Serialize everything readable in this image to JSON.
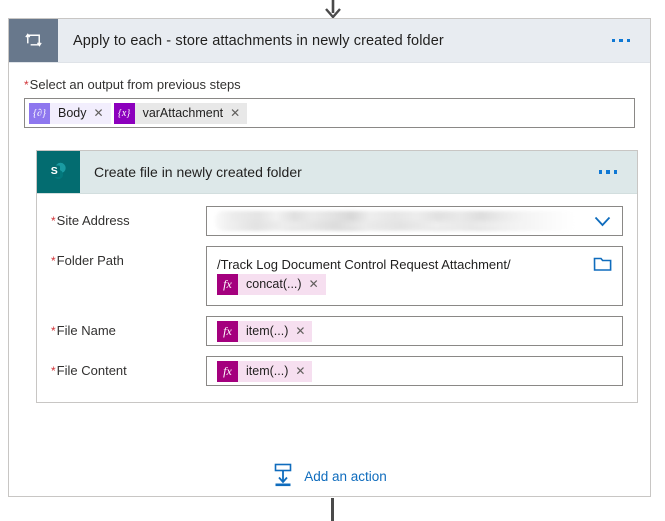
{
  "connector": {
    "top_arrow_icon": "arrow-down-icon",
    "bottom_stub_icon": "connector-line"
  },
  "loop_card": {
    "icon": "apply-to-each-loop-icon",
    "title": "Apply to each - store attachments in newly created folder",
    "menu_icon": "ellipsis-icon",
    "input_field": {
      "required": true,
      "asterisk": "*",
      "label": "Select an output from previous steps",
      "tokens": [
        {
          "icon_glyph": "{∂}",
          "icon_name": "dynamic-content-icon",
          "label": "Body",
          "remove_icon": "✕",
          "style": "body"
        },
        {
          "icon_glyph": "{x}",
          "icon_name": "variable-icon",
          "label": "varAttachment",
          "remove_icon": "✕",
          "style": "var"
        }
      ]
    }
  },
  "sharepoint_card": {
    "icon": "sharepoint-icon",
    "title": "Create file in newly created folder",
    "menu_icon": "ellipsis-icon",
    "fields": [
      {
        "key": "site_address",
        "asterisk": "*",
        "label": "Site Address",
        "type": "dropdown-redacted",
        "value": "",
        "trailing_icon": "chevron-down-icon"
      },
      {
        "key": "folder_path",
        "asterisk": "*",
        "label": "Folder Path",
        "type": "path-with-token",
        "value": "/Track Log  Document Control Request Attachment/",
        "token": {
          "icon_glyph": "fx",
          "icon_name": "expression-icon",
          "label": "concat(...)",
          "remove_icon": "✕"
        },
        "trailing_icon": "folder-picker-icon"
      },
      {
        "key": "file_name",
        "asterisk": "*",
        "label": "File Name",
        "type": "token",
        "token": {
          "icon_glyph": "fx",
          "icon_name": "expression-icon",
          "label": "item(...)",
          "remove_icon": "✕"
        }
      },
      {
        "key": "file_content",
        "asterisk": "*",
        "label": "File Content",
        "type": "token",
        "token": {
          "icon_glyph": "fx",
          "icon_name": "expression-icon",
          "label": "item(...)",
          "remove_icon": "✕"
        }
      }
    ]
  },
  "add_action": {
    "icon": "add-action-icon",
    "label": "Add an action"
  },
  "colors": {
    "loop_header_bg": "#e8ecf1",
    "loop_icon_bg": "#68788c",
    "sharepoint_header_bg": "#dde8e9",
    "sharepoint_icon_bg": "#036c70",
    "accent_blue": "#0f78d4",
    "link_blue": "#0f6cbd",
    "required_red": "#d13438",
    "expression_magenta": "#a4007e",
    "expression_chip_bg": "#f6dff0",
    "variable_purple": "#8c00bd",
    "dynamic_purple": "#8e77ef"
  }
}
